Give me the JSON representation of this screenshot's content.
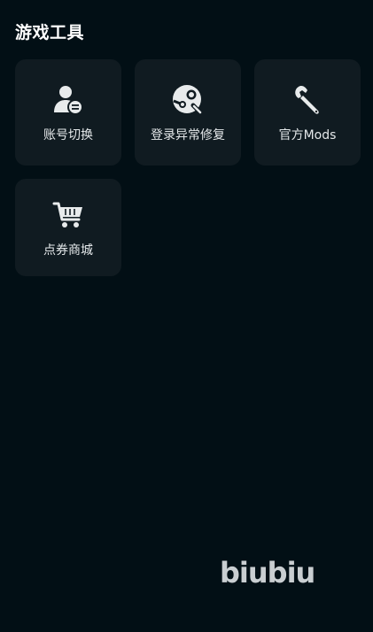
{
  "section": {
    "title": "游戏工具"
  },
  "tools": [
    {
      "label": "账号切换",
      "icon": "user-switch-icon"
    },
    {
      "label": "登录异常修复",
      "icon": "steam-repair-icon"
    },
    {
      "label": "官方Mods",
      "icon": "wrench-icon"
    },
    {
      "label": "点券商城",
      "icon": "cart-icon"
    }
  ],
  "brand": {
    "logo_text": "biubiu"
  },
  "colors": {
    "background": "#020f15",
    "tile": "#101b21",
    "text": "#e4e8ea",
    "icon": "#e8ebec"
  }
}
